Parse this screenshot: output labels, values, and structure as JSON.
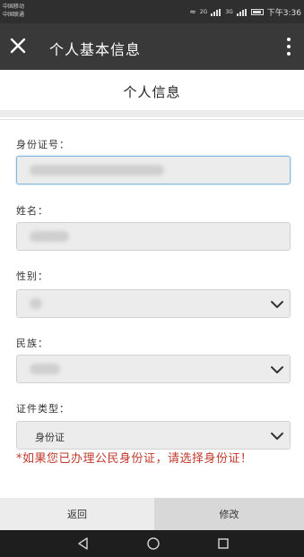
{
  "status_bar": {
    "left_line1": "中国移动",
    "left_line2": "中国联通",
    "network1": "2G",
    "network2": "3G",
    "time": "下午3:36"
  },
  "title_bar": {
    "title": "个人基本信息"
  },
  "page": {
    "heading": "个人信息"
  },
  "form": {
    "id_number_label": "身份证号：",
    "name_label": "姓名：",
    "gender_label": "性别：",
    "ethnicity_label": "民族：",
    "id_type_label": "证件类型：",
    "id_type_value": "身份证",
    "warning": "*如果您已办理公民身份证，请选择身份证！"
  },
  "buttons": {
    "back": "返回",
    "edit": "修改"
  },
  "icons": {
    "close": "close-icon",
    "more": "more-vert-icon",
    "chevron": "chevron-down-icon",
    "nav_back": "nav-back-icon",
    "nav_home": "nav-home-icon",
    "nav_recents": "nav-recents-icon"
  },
  "colors": {
    "title_bar": "#393939",
    "warning": "#c0392b",
    "field_focus": "#82b8e0"
  }
}
